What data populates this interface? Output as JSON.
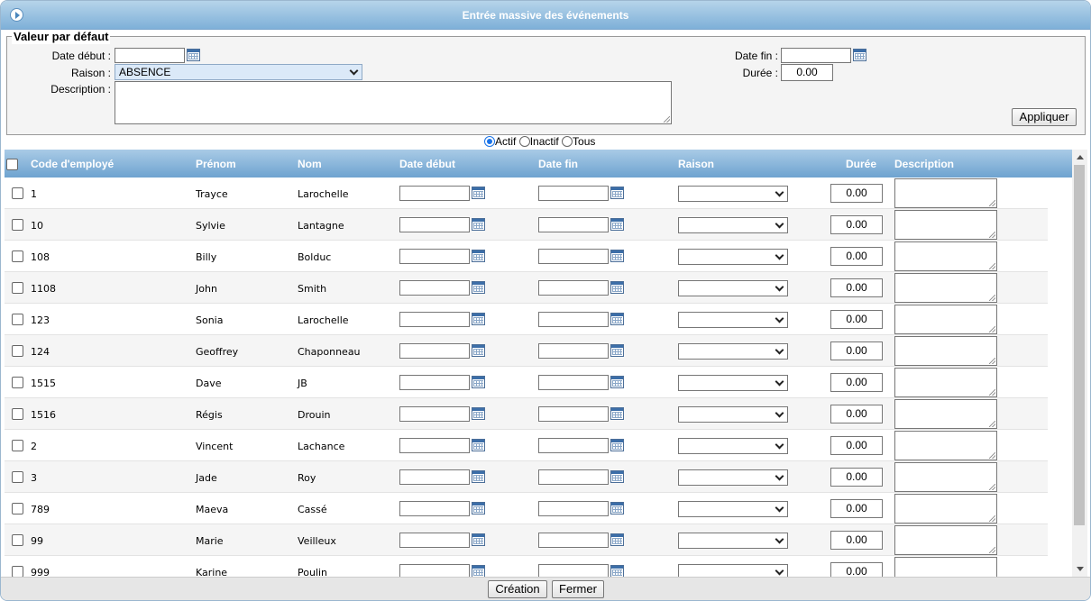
{
  "window": {
    "title": "Entrée massive des événements"
  },
  "defaults": {
    "legend": "Valeur par défaut",
    "date_debut_label": "Date début :",
    "date_debut_value": "",
    "raison_label": "Raison :",
    "raison_value": "ABSENCE",
    "description_label": "Description :",
    "date_fin_label": "Date fin :",
    "date_fin_value": "",
    "duree_label": "Durée :",
    "duree_value": "0.00",
    "apply_label": "Appliquer"
  },
  "filter": {
    "options": [
      "Actif",
      "Inactif",
      "Tous"
    ],
    "selected": "Actif"
  },
  "grid": {
    "headers": [
      "Code d'employé",
      "Prénom",
      "Nom",
      "Date début",
      "Date fin",
      "Raison",
      "Durée",
      "Description"
    ],
    "rows": [
      {
        "code": "1",
        "prenom": "Trayce",
        "nom": "Larochelle",
        "duree": "0.00"
      },
      {
        "code": "10",
        "prenom": "Sylvie",
        "nom": "Lantagne",
        "duree": "0.00"
      },
      {
        "code": "108",
        "prenom": "Billy",
        "nom": "Bolduc",
        "duree": "0.00"
      },
      {
        "code": "1108",
        "prenom": "John",
        "nom": "Smith",
        "duree": "0.00"
      },
      {
        "code": "123",
        "prenom": "Sonia",
        "nom": "Larochelle",
        "duree": "0.00"
      },
      {
        "code": "124",
        "prenom": "Geoffrey",
        "nom": "Chaponneau",
        "duree": "0.00"
      },
      {
        "code": "1515",
        "prenom": "Dave",
        "nom": "JB",
        "duree": "0.00"
      },
      {
        "code": "1516",
        "prenom": "Régis",
        "nom": "Drouin",
        "duree": "0.00"
      },
      {
        "code": "2",
        "prenom": "Vincent",
        "nom": "Lachance",
        "duree": "0.00"
      },
      {
        "code": "3",
        "prenom": "Jade",
        "nom": "Roy",
        "duree": "0.00"
      },
      {
        "code": "789",
        "prenom": "Maeva",
        "nom": "Cassé",
        "duree": "0.00"
      },
      {
        "code": "99",
        "prenom": "Marie",
        "nom": "Veilleux",
        "duree": "0.00"
      },
      {
        "code": "999",
        "prenom": "Karine",
        "nom": "Poulin",
        "duree": "0.00"
      }
    ]
  },
  "footer": {
    "create_label": "Création",
    "close_label": "Fermer"
  }
}
